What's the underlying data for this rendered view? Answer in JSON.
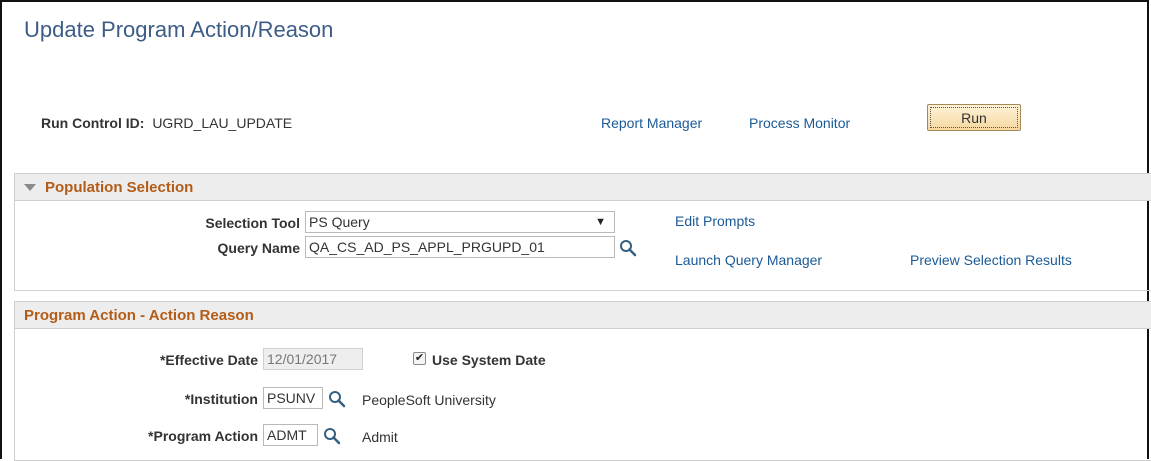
{
  "page": {
    "title": "Update Program Action/Reason"
  },
  "run_control": {
    "label": "Run Control ID:",
    "value": "UGRD_LAU_UPDATE",
    "report_manager": "Report Manager",
    "process_monitor": "Process Monitor",
    "run_label": "Run"
  },
  "population_selection": {
    "header": "Population Selection",
    "selection_tool_label": "Selection Tool",
    "selection_tool_value": "PS Query",
    "query_name_label": "Query Name",
    "query_name_value": "QA_CS_AD_PS_APPL_PRGUPD_01",
    "edit_prompts": "Edit Prompts",
    "launch_query_manager": "Launch Query Manager",
    "preview_selection_results": "Preview Selection Results"
  },
  "program_action": {
    "header": "Program Action - Action Reason",
    "effective_date_label": "*Effective Date",
    "effective_date_value": "12/01/2017",
    "use_system_date_label": "Use System Date",
    "use_system_date_checked": true,
    "institution_label": "*Institution",
    "institution_value": "PSUNV",
    "institution_desc": "PeopleSoft University",
    "program_action_label": "*Program Action",
    "program_action_value": "ADMT",
    "program_action_desc": "Admit"
  },
  "colors": {
    "title": "#3d5c86",
    "link": "#1a5a96",
    "section_header_text": "#b35c17",
    "run_button": "#f5d7a0"
  },
  "icons": {
    "lookup": "magnifier-icon",
    "collapse": "collapse-triangle-icon",
    "dropdown": "dropdown-arrow-icon"
  }
}
